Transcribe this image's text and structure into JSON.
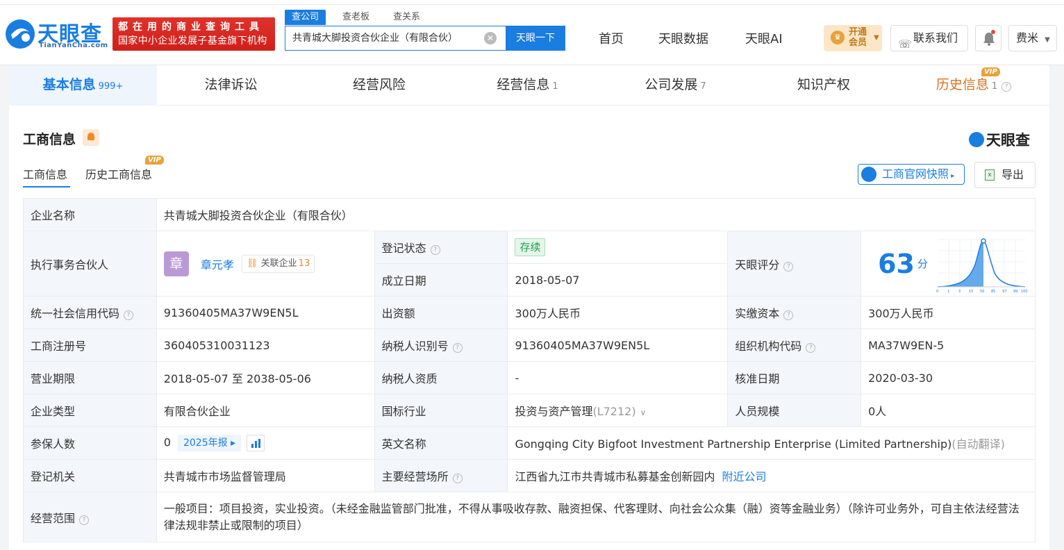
{
  "brand": {
    "name": "天眼查",
    "url": "TianYanCha.com"
  },
  "promo": {
    "line1": "都在用的商业查询工具",
    "line2": "国家中小企业发展子基金旗下机构"
  },
  "search": {
    "tabs": [
      "查公司",
      "查老板",
      "查关系"
    ],
    "value": "共青城大脚投资合伙企业（有限合伙）",
    "button": "天眼一下"
  },
  "nav": {
    "home": "首页",
    "data": "天眼数据",
    "ai": "天眼AI",
    "vip_line1": "开通",
    "vip_line2": "会员",
    "contact": "联系我们",
    "user": "费米"
  },
  "main_tabs": [
    {
      "label": "基本信息",
      "count": "999+"
    },
    {
      "label": "法律诉讼",
      "count": ""
    },
    {
      "label": "经营风险",
      "count": ""
    },
    {
      "label": "经营信息",
      "count": "1"
    },
    {
      "label": "公司发展",
      "count": "7"
    },
    {
      "label": "知识产权",
      "count": ""
    },
    {
      "label": "历史信息",
      "count": "1"
    }
  ],
  "vip_badge": "VIP",
  "section": {
    "title": "工商信息",
    "brand": "天眼查",
    "subtabs": [
      "工商信息",
      "历史工商信息"
    ],
    "snapshot_btn": "工商官网快照",
    "export_btn": "导出"
  },
  "info": {
    "company_name_k": "企业名称",
    "company_name": "共青城大脚投资合伙企业（有限合伙）",
    "partner_k": "执行事务合伙人",
    "partner_avatar": "章",
    "partner": "章元孝",
    "related_label": "关联企业",
    "related_count": "13",
    "reg_status_k": "登记状态",
    "reg_status": "存续",
    "founded_k": "成立日期",
    "founded": "2018-05-07",
    "score_k": "天眼评分",
    "score": "63",
    "score_unit": "分",
    "credit_code_k": "统一社会信用代码",
    "credit_code": "91360405MA37W9EN5L",
    "contribution_k": "出资额",
    "contribution": "300万人民币",
    "paid_capital_k": "实缴资本",
    "paid_capital": "300万人民币",
    "reg_no_k": "工商注册号",
    "reg_no": "360405310031123",
    "taxpayer_id_k": "纳税人识别号",
    "taxpayer_id": "91360405MA37W9EN5L",
    "org_code_k": "组织机构代码",
    "org_code": "MA37W9EN-5",
    "period_k": "营业期限",
    "period": "2018-05-07 至 2038-05-06",
    "tax_qual_k": "纳税人资质",
    "tax_qual": "-",
    "approve_date_k": "核准日期",
    "approve_date": "2020-03-30",
    "type_k": "企业类型",
    "type": "有限合伙企业",
    "industry_k": "国标行业",
    "industry": "投资与资产管理",
    "industry_code": "(L7212)",
    "staff_k": "人员规模",
    "staff": "0人",
    "insured_k": "参保人数",
    "insured": "0",
    "insured_year": "2025年报",
    "english_k": "英文名称",
    "english": "Gongqing City Bigfoot Investment Partnership Enterprise (Limited Partnership)",
    "english_note": "(自动翻译)",
    "authority_k": "登记机关",
    "authority": "共青城市市场监督管理局",
    "address_k": "主要经营场所",
    "address": "江西省九江市共青城市私募基金创新园内",
    "nearby": "附近公司",
    "scope_k": "经营范围",
    "scope": "一般项目：项目投资，实业投资。（未经金融监管部门批准，不得从事吸收存款、融资担保、代客理财、向社会公众集（融）资等金融业务）（除许可业务外，可自主依法经营法律法规非禁止或限制的项目）"
  },
  "score_chart": {
    "ticks": [
      "0",
      "1",
      "3",
      "15",
      "50",
      "85",
      "97",
      "99",
      "100"
    ]
  }
}
